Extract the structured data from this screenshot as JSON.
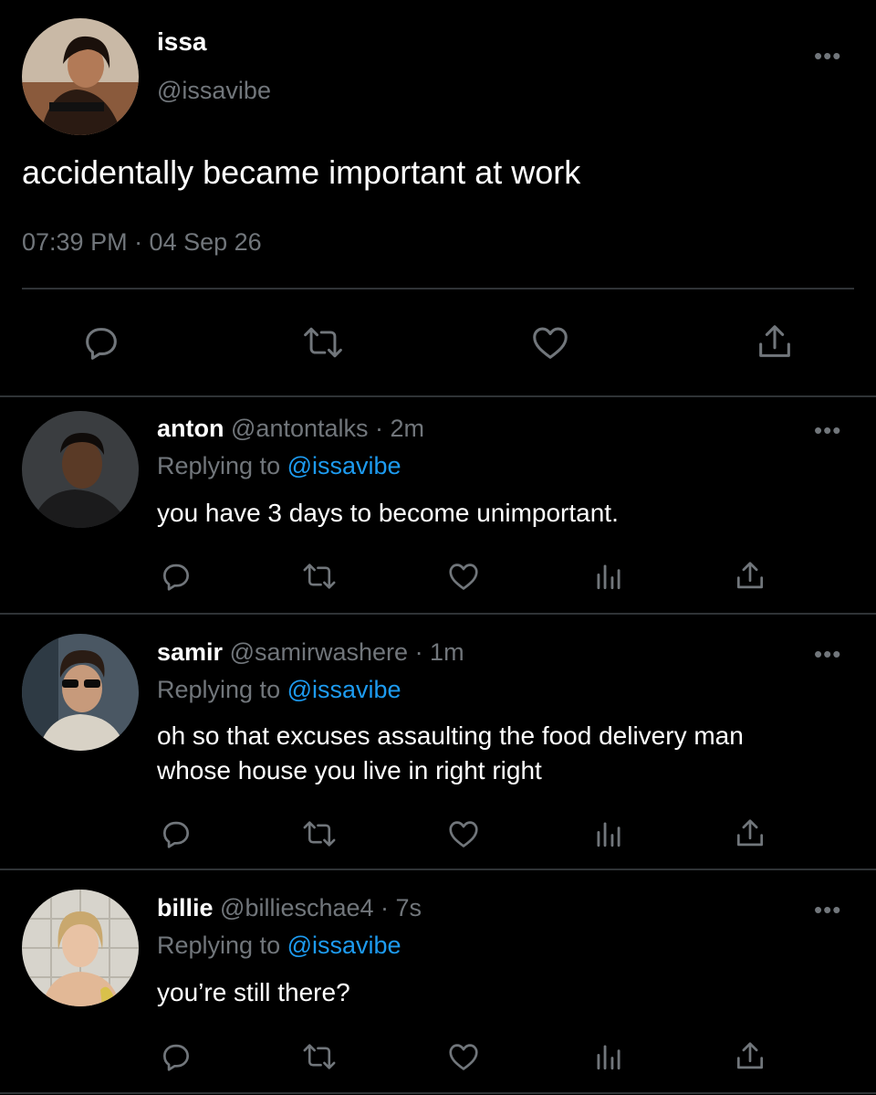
{
  "main_tweet": {
    "display_name": "issa",
    "handle": "@issavibe",
    "text": "accidentally became important at work",
    "timestamp": "07:39 PM · 04 Sep 26",
    "actions": [
      "reply-icon",
      "retweet-icon",
      "like-icon",
      "share-icon"
    ]
  },
  "replies": [
    {
      "display_name": "anton",
      "handle": "@antontalks",
      "time": "· 2m",
      "replying_prefix": "Replying to",
      "replying_handle": "@issavibe",
      "text": "you have 3 days to become unimportant."
    },
    {
      "display_name": "samir",
      "handle": "@samirwashere",
      "time": "· 1m",
      "replying_prefix": "Replying to",
      "replying_handle": "@issavibe",
      "text_line1": "oh so that excuses assaulting the food delivery man",
      "text_line2": "whose house you live in right right"
    },
    {
      "display_name": "billie",
      "handle": "@billieschae4",
      "time": "· 7s",
      "replying_prefix": "Replying to",
      "replying_handle": "@issavibe",
      "text": "you’re still there?"
    }
  ],
  "more_glyph": "•••",
  "colors": {
    "background": "#000000",
    "text": "#e7e9ea",
    "muted": "#71767b",
    "link": "#1d9bf0",
    "divider": "#2f3336"
  }
}
